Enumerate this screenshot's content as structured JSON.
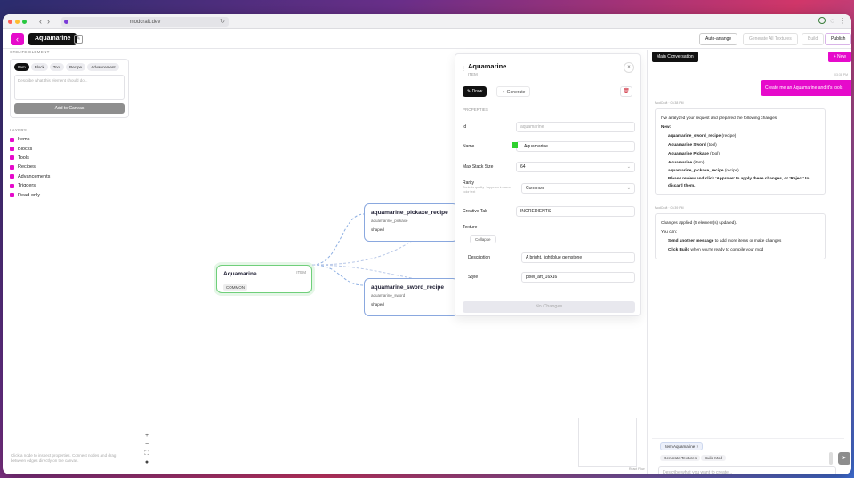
{
  "browser": {
    "url": "modcraft.dev",
    "nav_back": "‹",
    "nav_forward": "›",
    "reload": "↻",
    "menu": "⋮"
  },
  "header": {
    "back_icon": "‹",
    "project_name": "Aquamarine",
    "edit_icon": "✎",
    "buttons": {
      "auto_arrange": "Auto-arrange",
      "generate_all_textures": "Generate All Textures",
      "build": "Build",
      "publish": "Publish"
    }
  },
  "create_element": {
    "title": "CREATE ELEMENT",
    "types": [
      "Item",
      "Block",
      "Tool",
      "Recipe",
      "Advancement"
    ],
    "placeholder": "Describe what this element should do...",
    "add_button": "Add to Canvas"
  },
  "layers": {
    "title": "LAYERS",
    "items": [
      "Items",
      "Blocks",
      "Tools",
      "Recipes",
      "Advancements",
      "Triggers",
      "Read-only"
    ]
  },
  "canvas": {
    "help_text": "Click a node to inspect properties. Connect nodes and drag between edges directly on the canvas.",
    "zoom_in": "+",
    "zoom_out": "−",
    "fit": "⛶",
    "lock": "●",
    "attribution": "React Flow",
    "nodes": {
      "main": {
        "title": "Aquamarine",
        "type": "ITEM",
        "rarity": "COMMON"
      },
      "pickaxe": {
        "title": "aquamarine_pickaxe_recipe",
        "id": "aquamarine_pickaxe",
        "tag": "shaped"
      },
      "sword": {
        "title": "aquamarine_sword_recipe",
        "id": "aquamarine_sword",
        "tag": "shaped"
      }
    }
  },
  "properties": {
    "title": "Aquamarine",
    "subtitle": "ITEM",
    "tabs": {
      "draw": "Draw",
      "generate": "Generate"
    },
    "section": "PROPERTIES",
    "fields": {
      "id_label": "Id",
      "id_value": "aquamarine",
      "name_label": "Name",
      "name_value": "Aquamarine",
      "stack_label": "Max Stack Size",
      "stack_value": "64",
      "rarity_label": "Rarity",
      "rarity_hint": "Controls quality + appears in name color text",
      "rarity_value": "Common",
      "tab_label": "Creative Tab",
      "tab_value": "INGREDIENTS",
      "texture_label": "Texture",
      "texture_btn": "Collapse",
      "desc_label": "Description",
      "desc_value": "A bright, light blue gemstone",
      "style_label": "Style",
      "style_value": "pixel_art_16x16"
    },
    "no_changes": "No Changes"
  },
  "chat": {
    "conversation_tab": "Main Conversation",
    "new_button": "+ New",
    "user_meta": "03:38 PM",
    "user_message": "Create me an Aquamarine and it's tools",
    "assistant1_meta": "ModCraft · 03:38 PM",
    "assistant1": {
      "intro": "I've analyzed your request and prepared the following changes:",
      "new_label": "New:",
      "items": [
        {
          "name": "aquamarine_sword_recipe",
          "kind": "(recipe)"
        },
        {
          "name": "Aquamarine Sword",
          "kind": "(tool)"
        },
        {
          "name": "Aquamarine Pickaxe",
          "kind": "(tool)"
        },
        {
          "name": "Aquamarine",
          "kind": "(item)"
        },
        {
          "name": "aquamarine_pickaxe_recipe",
          "kind": "(recipe)"
        }
      ],
      "outro": "Please review and click 'Approve' to apply these changes, or 'Reject' to discard them."
    },
    "assistant2_meta": "ModCraft · 03:39 PM",
    "assistant2": {
      "line1": "Changes applied (5 element(s) updated).",
      "line2": "You can:",
      "opt1_bold": "Send another message",
      "opt1_rest": " to add more items or make changes",
      "opt2_bold": "Click Build",
      "opt2_rest": " when you're ready to compile your mod"
    },
    "context_chip": "Item:Aquamarine ×",
    "suggestions": [
      "Generate Textures",
      "Build Mod"
    ],
    "input_placeholder": "Describe what you want to create...",
    "send_icon": "➤"
  },
  "colors": {
    "accent": "#e60acb",
    "node_main": "#6fcf7a",
    "node_recipe": "#8aa8df"
  }
}
